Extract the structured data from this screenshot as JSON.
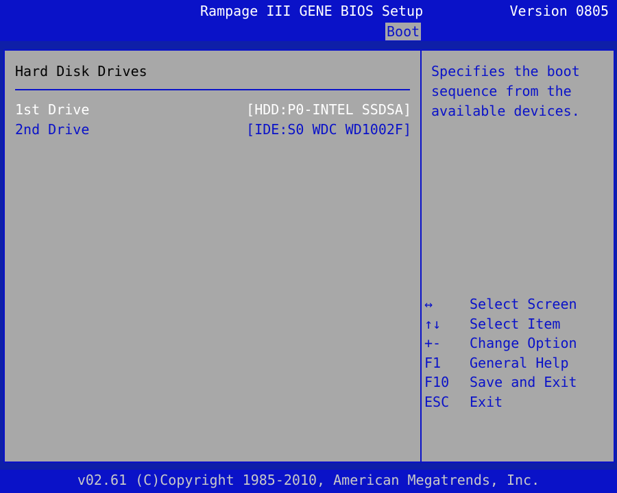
{
  "header": {
    "title": "Rampage III GENE BIOS Setup",
    "version": "Version 0805"
  },
  "menu": {
    "active_tab": "Boot"
  },
  "section": {
    "title": "Hard Disk Drives",
    "items": [
      {
        "label": "1st Drive",
        "value": "[HDD:P0-INTEL SSDSA]",
        "selected": true
      },
      {
        "label": "2nd Drive",
        "value": "[IDE:S0 WDC WD1002F]",
        "selected": false
      }
    ]
  },
  "help": {
    "text": "Specifies the boot sequence from the available devices."
  },
  "keys": [
    {
      "key": "↔",
      "desc": "Select Screen"
    },
    {
      "key": "↑↓",
      "desc": "Select Item"
    },
    {
      "key": "+-",
      "desc": "Change Option"
    },
    {
      "key": "F1",
      "desc": "General Help"
    },
    {
      "key": "F10",
      "desc": "Save and Exit"
    },
    {
      "key": "ESC",
      "desc": "Exit"
    }
  ],
  "footer": {
    "copyright": "v02.61 (C)Copyright 1985-2010, American Megatrends, Inc."
  },
  "colors": {
    "background": "#0a12c8",
    "panel": "#a8a8a8",
    "accent": "#0a12c8",
    "selected_text": "#ffffff"
  }
}
